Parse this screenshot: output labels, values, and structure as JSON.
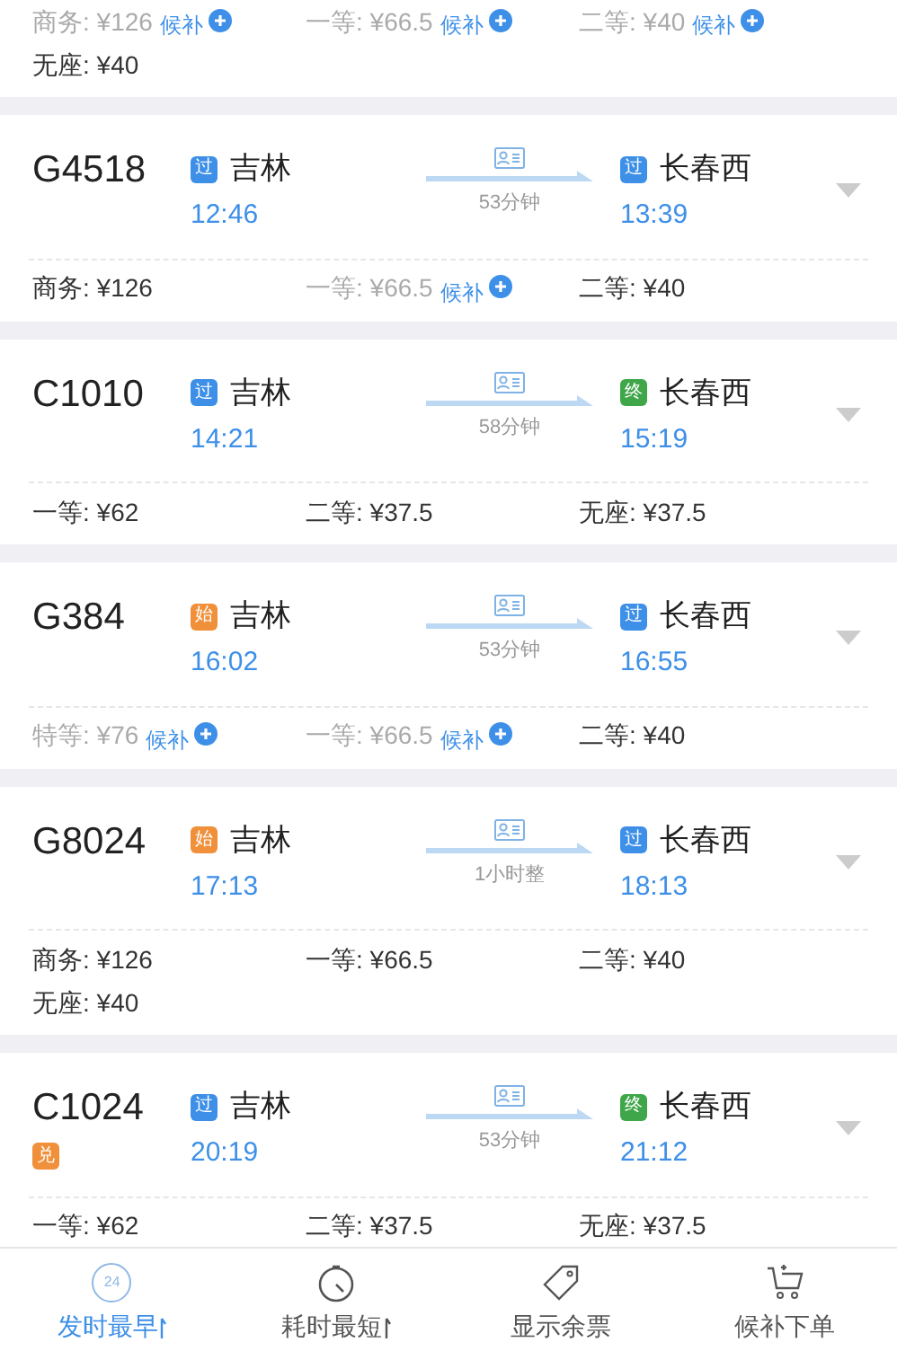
{
  "trains": [
    {
      "seats": [
        {
          "label": "商务: ¥126",
          "available": false,
          "waitlist": "候补"
        },
        {
          "label": "一等: ¥66.5",
          "available": false,
          "waitlist": "候补"
        },
        {
          "label": "二等: ¥40",
          "available": false,
          "waitlist": "候补"
        },
        {
          "label": "无座: ¥40",
          "available": true
        }
      ]
    },
    {
      "number": "G4518",
      "from": {
        "badge": "过",
        "kind": "pass",
        "name": "吉林",
        "time": "12:46"
      },
      "duration": "53分钟",
      "to": {
        "badge": "过",
        "kind": "pass",
        "name": "长春西",
        "time": "13:39"
      },
      "seats": [
        {
          "label": "商务: ¥126",
          "available": true
        },
        {
          "label": "一等: ¥66.5",
          "available": false,
          "waitlist": "候补"
        },
        {
          "label": "二等: ¥40",
          "available": true
        }
      ]
    },
    {
      "number": "C1010",
      "from": {
        "badge": "过",
        "kind": "pass",
        "name": "吉林",
        "time": "14:21"
      },
      "duration": "58分钟",
      "to": {
        "badge": "终",
        "kind": "end",
        "name": "长春西",
        "time": "15:19"
      },
      "seats": [
        {
          "label": "一等: ¥62",
          "available": true
        },
        {
          "label": "二等: ¥37.5",
          "available": true
        },
        {
          "label": "无座: ¥37.5",
          "available": true
        }
      ]
    },
    {
      "number": "G384",
      "from": {
        "badge": "始",
        "kind": "start",
        "name": "吉林",
        "time": "16:02"
      },
      "duration": "53分钟",
      "to": {
        "badge": "过",
        "kind": "pass",
        "name": "长春西",
        "time": "16:55"
      },
      "seats": [
        {
          "label": "特等: ¥76",
          "available": false,
          "waitlist": "候补"
        },
        {
          "label": "一等: ¥66.5",
          "available": false,
          "waitlist": "候补"
        },
        {
          "label": "二等: ¥40",
          "available": true
        }
      ]
    },
    {
      "number": "G8024",
      "from": {
        "badge": "始",
        "kind": "start",
        "name": "吉林",
        "time": "17:13"
      },
      "duration": "1小时整",
      "to": {
        "badge": "过",
        "kind": "pass",
        "name": "长春西",
        "time": "18:13"
      },
      "seats": [
        {
          "label": "商务: ¥126",
          "available": true
        },
        {
          "label": "一等: ¥66.5",
          "available": true
        },
        {
          "label": "二等: ¥40",
          "available": true
        },
        {
          "label": "无座: ¥40",
          "available": true
        }
      ]
    },
    {
      "number": "C1024",
      "tag": "兑",
      "from": {
        "badge": "过",
        "kind": "pass",
        "name": "吉林",
        "time": "20:19"
      },
      "duration": "53分钟",
      "to": {
        "badge": "终",
        "kind": "end",
        "name": "长春西",
        "time": "21:12"
      },
      "seats": [
        {
          "label": "一等: ¥62",
          "available": true
        },
        {
          "label": "二等: ¥37.5",
          "available": true
        },
        {
          "label": "无座: ¥37.5",
          "available": true
        }
      ]
    }
  ],
  "bottom_bar": [
    {
      "kind": "clock24",
      "icon_text": "24",
      "label": "发时最早",
      "sort": true,
      "selected": true
    },
    {
      "kind": "timer",
      "label": "耗时最短",
      "sort": true,
      "selected": false
    },
    {
      "kind": "tag",
      "label": "显示余票",
      "sort": false,
      "selected": false
    },
    {
      "kind": "cart",
      "label": "候补下单",
      "sort": false,
      "selected": false
    }
  ]
}
